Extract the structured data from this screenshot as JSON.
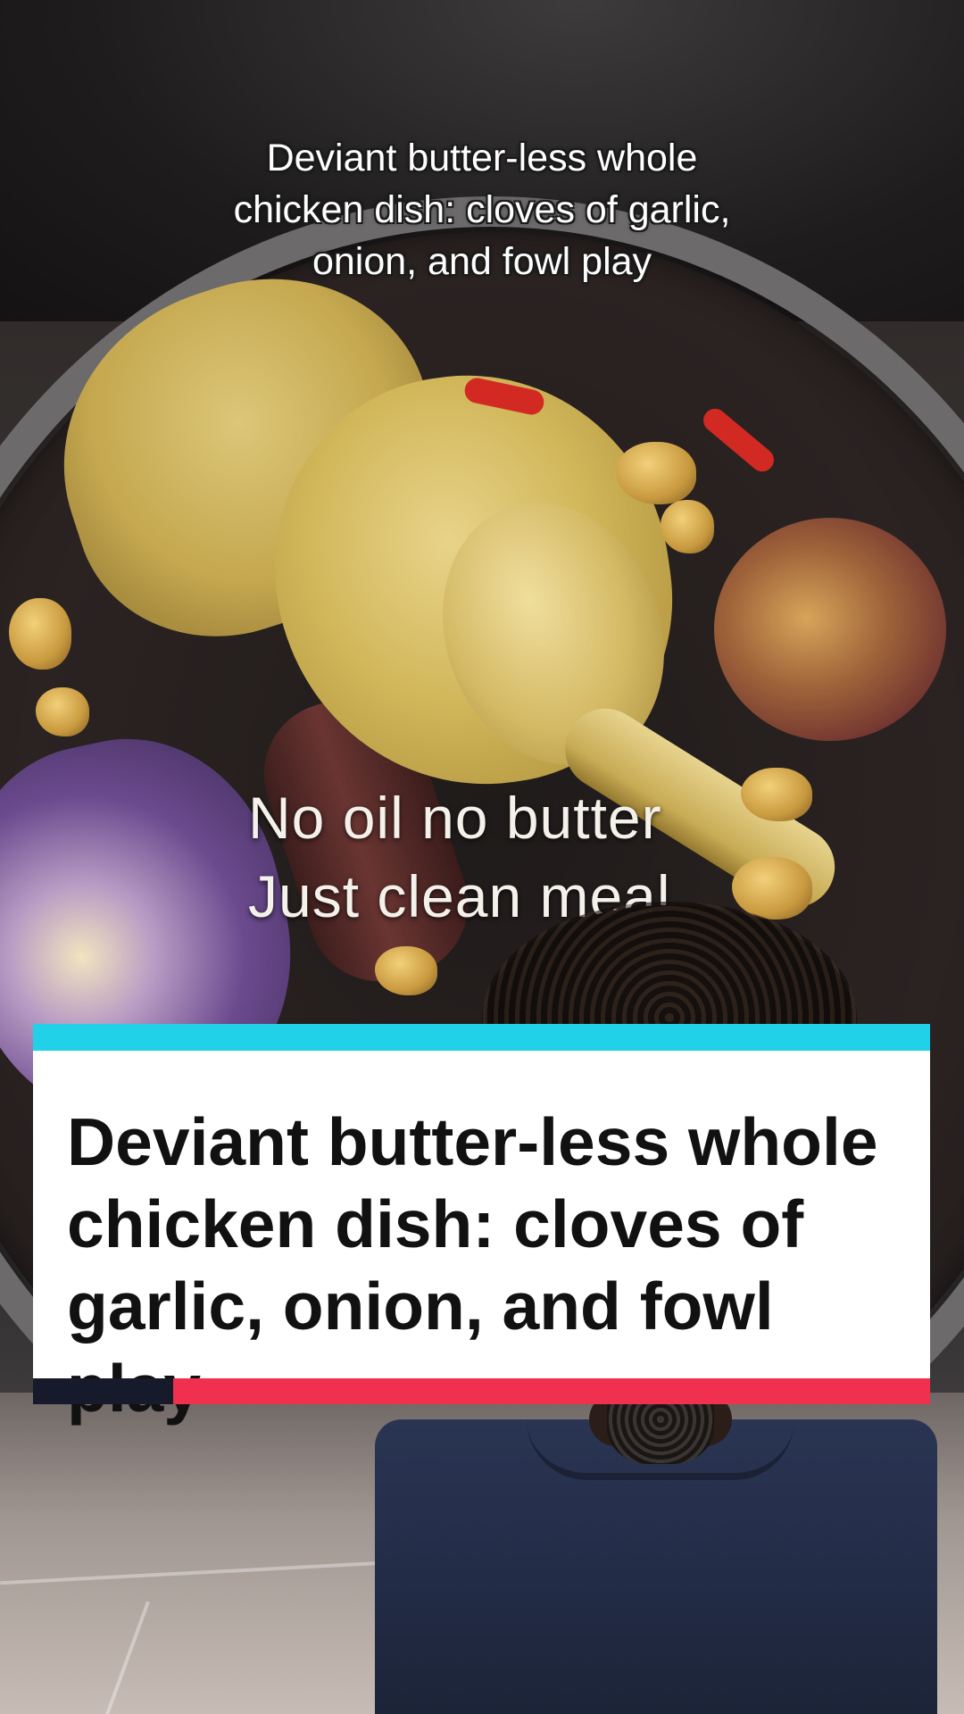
{
  "video": {
    "top_caption": "Deviant butter-less whole chicken dish: cloves of garlic, onion, and fowl play",
    "overlay_text": {
      "line1": "No oil no butter",
      "line2": "Just clean meal"
    }
  },
  "headline_card": {
    "title": "Deviant butter-less whole chicken dish: cloves of garlic, onion, and fowl play",
    "colors": {
      "top_bar": "#21d1e8",
      "bottom_bar_dark": "#161a2a",
      "bottom_bar_accent": "#f0304f"
    }
  }
}
